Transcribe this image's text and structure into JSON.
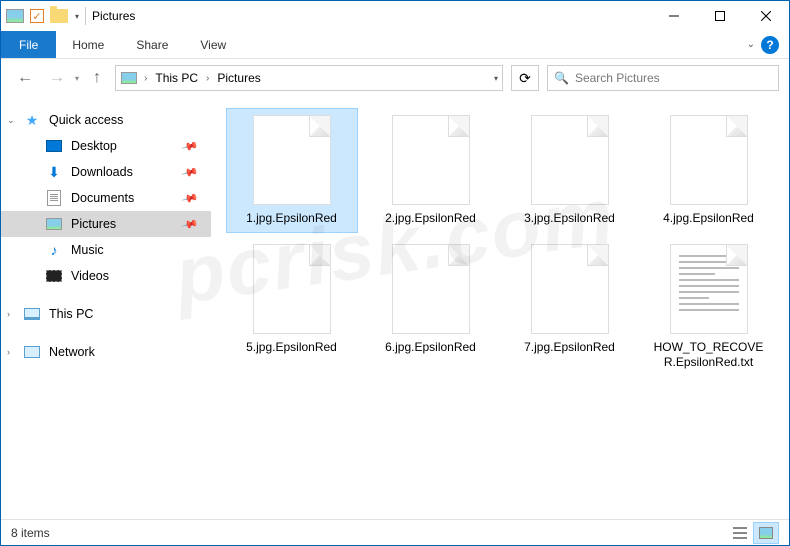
{
  "window": {
    "title": "Pictures"
  },
  "ribbon": {
    "file": "File",
    "tabs": [
      "Home",
      "Share",
      "View"
    ]
  },
  "breadcrumb": {
    "root": "This PC",
    "current": "Pictures"
  },
  "search": {
    "placeholder": "Search Pictures"
  },
  "sidebar": {
    "quick_access": "Quick access",
    "items": [
      {
        "label": "Desktop",
        "pinned": true
      },
      {
        "label": "Downloads",
        "pinned": true
      },
      {
        "label": "Documents",
        "pinned": true
      },
      {
        "label": "Pictures",
        "pinned": true,
        "selected": true
      },
      {
        "label": "Music",
        "pinned": false
      },
      {
        "label": "Videos",
        "pinned": false
      }
    ],
    "this_pc": "This PC",
    "network": "Network"
  },
  "files": [
    {
      "name": "1.jpg.EpsilonRed",
      "type": "file",
      "selected": true
    },
    {
      "name": "2.jpg.EpsilonRed",
      "type": "file"
    },
    {
      "name": "3.jpg.EpsilonRed",
      "type": "file"
    },
    {
      "name": "4.jpg.EpsilonRed",
      "type": "file"
    },
    {
      "name": "5.jpg.EpsilonRed",
      "type": "file"
    },
    {
      "name": "6.jpg.EpsilonRed",
      "type": "file"
    },
    {
      "name": "7.jpg.EpsilonRed",
      "type": "file"
    },
    {
      "name": "HOW_TO_RECOVER.EpsilonRed.txt",
      "type": "txt"
    }
  ],
  "status": {
    "count": "8 items"
  }
}
